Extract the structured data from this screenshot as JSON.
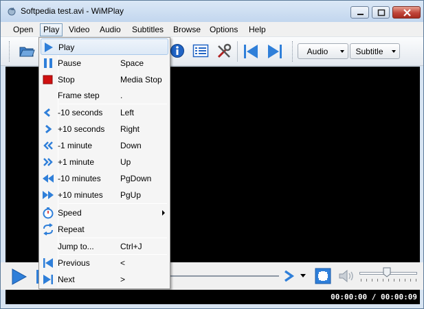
{
  "window": {
    "title": "Softpedia test.avi - WiMPlay"
  },
  "menubar": {
    "items": [
      "Open",
      "Play",
      "Video",
      "Audio",
      "Subtitles",
      "Browse",
      "Options",
      "Help"
    ],
    "active": "Play"
  },
  "toolbar": {
    "audio_label": "Audio",
    "subtitle_label": "Subtitle"
  },
  "play_menu": {
    "items": [
      {
        "label": "Play",
        "shortcut": ""
      },
      {
        "label": "Pause",
        "shortcut": "Space"
      },
      {
        "label": "Stop",
        "shortcut": "Media Stop"
      },
      {
        "label": "Frame step",
        "shortcut": "."
      },
      {
        "label": "-10 seconds",
        "shortcut": "Left"
      },
      {
        "label": "+10 seconds",
        "shortcut": "Right"
      },
      {
        "label": "-1 minute",
        "shortcut": "Down"
      },
      {
        "label": "+1 minute",
        "shortcut": "Up"
      },
      {
        "label": "-10 minutes",
        "shortcut": "PgDown"
      },
      {
        "label": "+10 minutes",
        "shortcut": "PgUp"
      },
      {
        "label": "Speed",
        "shortcut": ""
      },
      {
        "label": "Repeat",
        "shortcut": ""
      },
      {
        "label": "Jump to...",
        "shortcut": "Ctrl+J"
      },
      {
        "label": "Previous",
        "shortcut": "<"
      },
      {
        "label": "Next",
        "shortcut": ">"
      }
    ]
  },
  "status": {
    "time": "00:00:00 / 00:00:09"
  },
  "colors": {
    "accent_blue": "#2f7fd9",
    "stop_red": "#d01010",
    "video_bg": "#000000"
  }
}
